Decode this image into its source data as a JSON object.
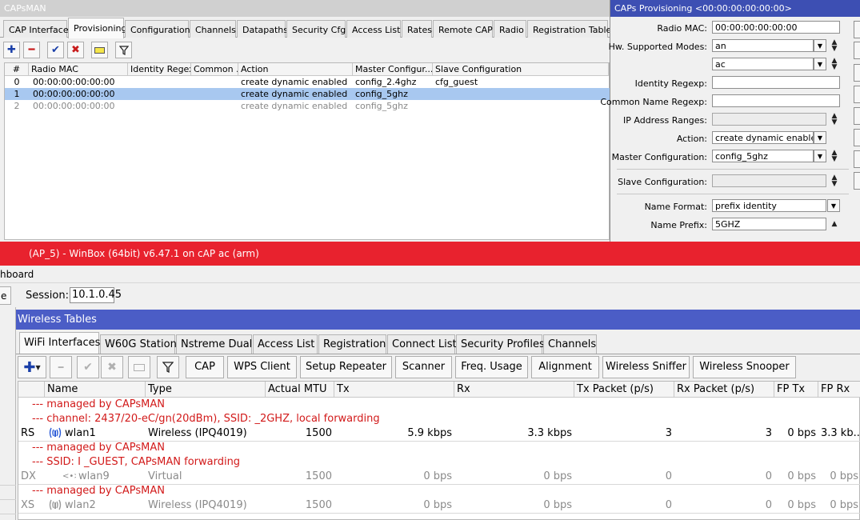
{
  "capsman": {
    "title": "CAPsMAN",
    "tabs": [
      "CAP Interface",
      "Provisioning",
      "Configurations",
      "Channels",
      "Datapaths",
      "Security Cfg.",
      "Access List",
      "Rates",
      "Remote CAP",
      "Radio",
      "Registration Table"
    ],
    "active_tab": "Provisioning",
    "columns": [
      "#",
      "Radio MAC",
      "Identity Regexp",
      "Common ...",
      "Action",
      "Master Configur...",
      "Slave Configuration"
    ],
    "rows": [
      {
        "num": "0",
        "mac": "00:00:00:00:00:00",
        "identity": "",
        "common": "",
        "action": "create dynamic enabled",
        "master": "config_2.4ghz",
        "slave": "cfg_guest",
        "state": "normal"
      },
      {
        "num": "1",
        "mac": "00:00:00:00:00:00",
        "identity": "",
        "common": "",
        "action": "create dynamic enabled",
        "master": "config_5ghz",
        "slave": "",
        "state": "selected"
      },
      {
        "num": "2",
        "mac": "00:00:00:00:00:00",
        "identity": "",
        "common": "",
        "action": "create dynamic enabled",
        "master": "config_5ghz",
        "slave": "",
        "state": "disabled"
      }
    ]
  },
  "provisioning_dialog": {
    "title": "CAPs Provisioning <00:00:00:00:00:00>",
    "labels": {
      "radio_mac": "Radio MAC:",
      "hw_modes": "Hw. Supported Modes:",
      "identity_regexp": "Identity Regexp:",
      "common_name_regexp": "Common Name Regexp:",
      "ip_ranges": "IP Address Ranges:",
      "action": "Action:",
      "master_config": "Master Configuration:",
      "slave_config": "Slave Configuration:",
      "name_format": "Name Format:",
      "name_prefix": "Name Prefix:"
    },
    "values": {
      "radio_mac": "00:00:00:00:00:00",
      "hw_mode_1": "an",
      "hw_mode_2": "ac",
      "identity_regexp": "",
      "common_name_regexp": "",
      "ip_ranges": "",
      "action": "create dynamic enabled",
      "master_config": "config_5ghz",
      "slave_config": "",
      "name_format": "prefix identity",
      "name_prefix": "5GHZ"
    }
  },
  "winbox": {
    "title_visible": "(AP_5) - WinBox (64bit) v6.47.1 on cAP ac (arm)",
    "dashboard_label": "hboard",
    "left_button": "e",
    "session_label": "Session:",
    "session_value": "10.1.0.45"
  },
  "wireless_tables": {
    "title": "Wireless Tables",
    "tabs": [
      "WiFi Interfaces",
      "W60G Station",
      "Nstreme Dual",
      "Access List",
      "Registration",
      "Connect List",
      "Security Profiles",
      "Channels"
    ],
    "active_tab": "WiFi Interfaces",
    "buttons": [
      "CAP",
      "WPS Client",
      "Setup Repeater",
      "Scanner",
      "Freq. Usage",
      "Alignment",
      "Wireless Sniffer",
      "Wireless Snooper"
    ],
    "columns": [
      "Name",
      "Type",
      "Actual MTU",
      "Tx",
      "Rx",
      "Tx Packet (p/s)",
      "Rx Packet (p/s)",
      "FP Tx",
      "FP Rx"
    ],
    "rows": [
      {
        "kind": "comment",
        "text": "--- managed by CAPsMAN"
      },
      {
        "kind": "comment",
        "text": "--- channel: 2437/20-eC/gn(20dBm), SSID:                _2GHZ, local forwarding"
      },
      {
        "kind": "iface",
        "flags": "RS",
        "icon": "wireless-interface-icon",
        "name": "wlan1",
        "type": "Wireless (IPQ4019)",
        "mtu": "1500",
        "tx": "5.9 kbps",
        "rx": "3.3 kbps",
        "txp": "3",
        "rxp": "3",
        "fptx": "0 bps",
        "fprx": "3.3 kb...",
        "state": "normal"
      },
      {
        "kind": "comment",
        "text": "--- managed by CAPsMAN"
      },
      {
        "kind": "comment",
        "text": "--- SSID: I                 _GUEST, CAPsMAN forwarding"
      },
      {
        "kind": "iface",
        "flags": "DX",
        "icon": "virtual-interface-icon",
        "name": "wlan9",
        "type": "Virtual",
        "mtu": "1500",
        "tx": "0 bps",
        "rx": "0 bps",
        "txp": "0",
        "rxp": "0",
        "fptx": "0 bps",
        "fprx": "0 bps",
        "state": "disabled"
      },
      {
        "kind": "comment",
        "text": "--- managed by CAPsMAN"
      },
      {
        "kind": "iface",
        "flags": "XS",
        "icon": "wireless-interface-icon",
        "name": "wlan2",
        "type": "Wireless (IPQ4019)",
        "mtu": "1500",
        "tx": "0 bps",
        "rx": "0 bps",
        "txp": "0",
        "rxp": "0",
        "fptx": "0 bps",
        "fprx": "0 bps",
        "state": "disabled"
      }
    ]
  },
  "colors": {
    "winbox_titlebar": "#e8222e",
    "dialog_titlebar": "#3d4fb3",
    "wireless_titlebar": "#4b5dc6",
    "selected_row": "#a8c8f0",
    "comment_text": "#d21a1a"
  }
}
